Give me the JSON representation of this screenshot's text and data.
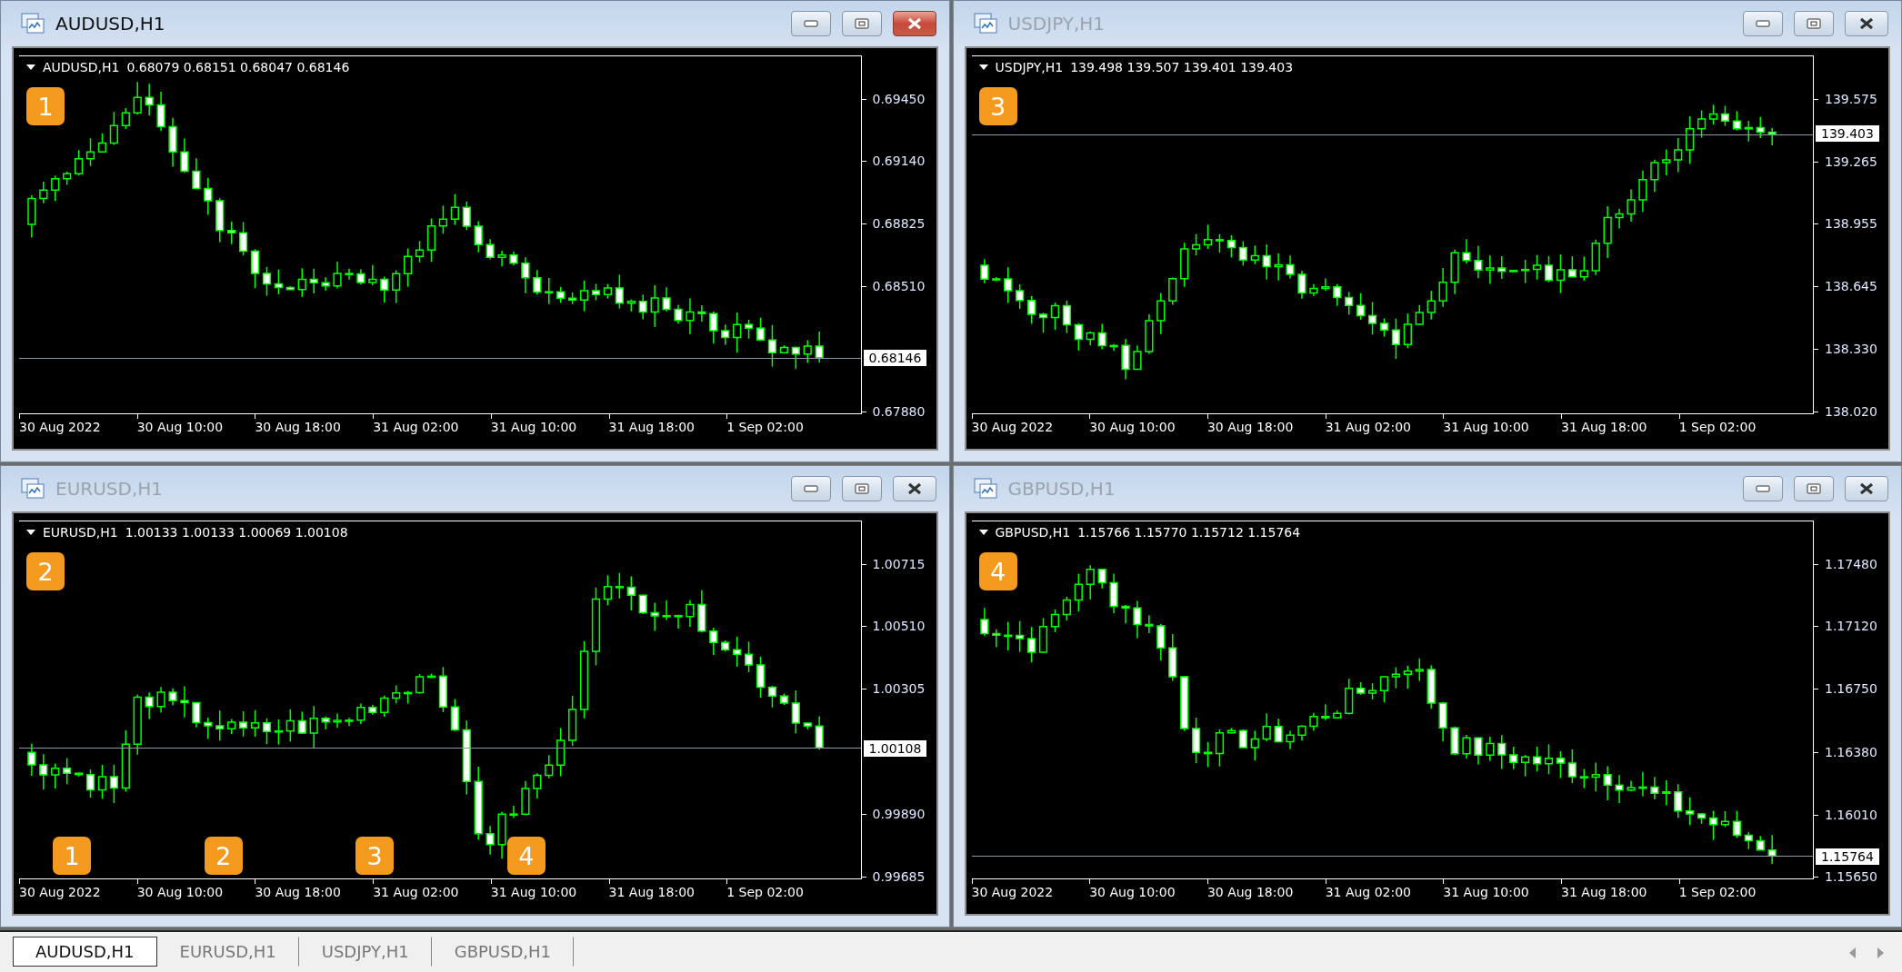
{
  "windows": [
    {
      "title": "AUDUSD,H1",
      "active": true,
      "symbol": "AUDUSD,H1",
      "ohlc": "0.68079 0.68151 0.68047 0.68146",
      "badge": "1",
      "price_ticks": [
        "0.69450",
        "0.69140",
        "0.68825",
        "0.68510",
        "0.67880"
      ],
      "last_price": "0.68146",
      "time_labels": [
        "30 Aug 2022",
        "30 Aug 10:00",
        "30 Aug 18:00",
        "31 Aug 02:00",
        "31 Aug 10:00",
        "31 Aug 18:00",
        "1 Sep 02:00"
      ]
    },
    {
      "title": "USDJPY,H1",
      "active": false,
      "symbol": "USDJPY,H1",
      "ohlc": "139.498 139.507 139.401 139.403",
      "badge": "3",
      "price_ticks": [
        "139.575",
        "139.265",
        "138.955",
        "138.645",
        "138.330",
        "138.020"
      ],
      "last_price": "139.403",
      "time_labels": [
        "30 Aug 2022",
        "30 Aug 10:00",
        "30 Aug 18:00",
        "31 Aug 02:00",
        "31 Aug 10:00",
        "31 Aug 18:00",
        "1 Sep 02:00"
      ]
    },
    {
      "title": "EURUSD,H1",
      "active": false,
      "symbol": "EURUSD,H1",
      "ohlc": "1.00133 1.00133 1.00069 1.00108",
      "badge": "2",
      "price_ticks": [
        "1.00715",
        "1.00510",
        "1.00305",
        "0.99890",
        "0.99685"
      ],
      "last_price": "1.00108",
      "time_labels": [
        "30 Aug 2022",
        "30 Aug 10:00",
        "30 Aug 18:00",
        "31 Aug 02:00",
        "31 Aug 10:00",
        "31 Aug 18:00",
        "1 Sep 02:00"
      ],
      "bottom_badges": [
        "1",
        "2",
        "3",
        "4"
      ]
    },
    {
      "title": "GBPUSD,H1",
      "active": false,
      "symbol": "GBPUSD,H1",
      "ohlc": "1.15766 1.15770 1.15712 1.15764",
      "badge": "4",
      "price_ticks": [
        "1.17480",
        "1.17120",
        "1.16750",
        "1.16380",
        "1.16010",
        "1.15650"
      ],
      "last_price": "1.15764",
      "time_labels": [
        "30 Aug 2022",
        "30 Aug 10:00",
        "30 Aug 18:00",
        "31 Aug 02:00",
        "31 Aug 10:00",
        "31 Aug 18:00",
        "1 Sep 02:00"
      ]
    }
  ],
  "tabs": [
    {
      "label": "AUDUSD,H1",
      "selected": true
    },
    {
      "label": "EURUSD,H1",
      "selected": false
    },
    {
      "label": "USDJPY,H1",
      "selected": false
    },
    {
      "label": "GBPUSD,H1",
      "selected": false
    }
  ]
}
